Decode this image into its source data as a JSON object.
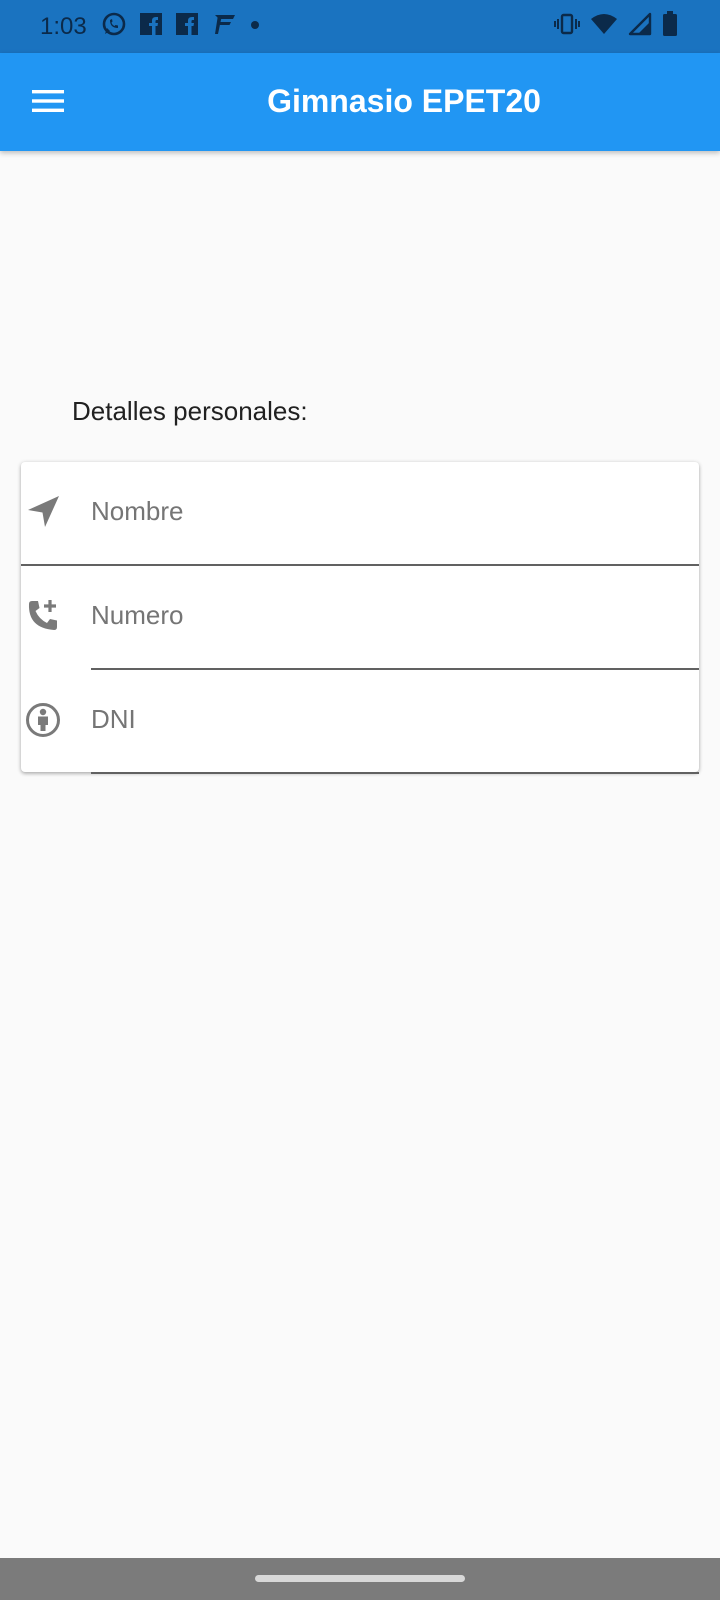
{
  "status_bar": {
    "time": "1:03",
    "left_icons": [
      "whatsapp-icon",
      "facebook-icon",
      "facebook-icon",
      "flash-app-icon",
      "dot-icon"
    ],
    "right_icons": [
      "vibrate-icon",
      "wifi-icon",
      "signal-icon",
      "battery-icon"
    ],
    "background": "#1a73c0"
  },
  "app_bar": {
    "title": "Gimnasio EPET20",
    "menu_icon": "menu-icon",
    "background": "#2196f3"
  },
  "form": {
    "section_label": "Detalles personales:",
    "fields": [
      {
        "icon": "navigation-icon",
        "placeholder": "Nombre",
        "value": ""
      },
      {
        "icon": "add-call-icon",
        "placeholder": "Numero",
        "value": ""
      },
      {
        "icon": "person-badge-icon",
        "placeholder": "DNI",
        "value": ""
      }
    ]
  },
  "nav_bar": {
    "background": "#7b7b7b"
  }
}
